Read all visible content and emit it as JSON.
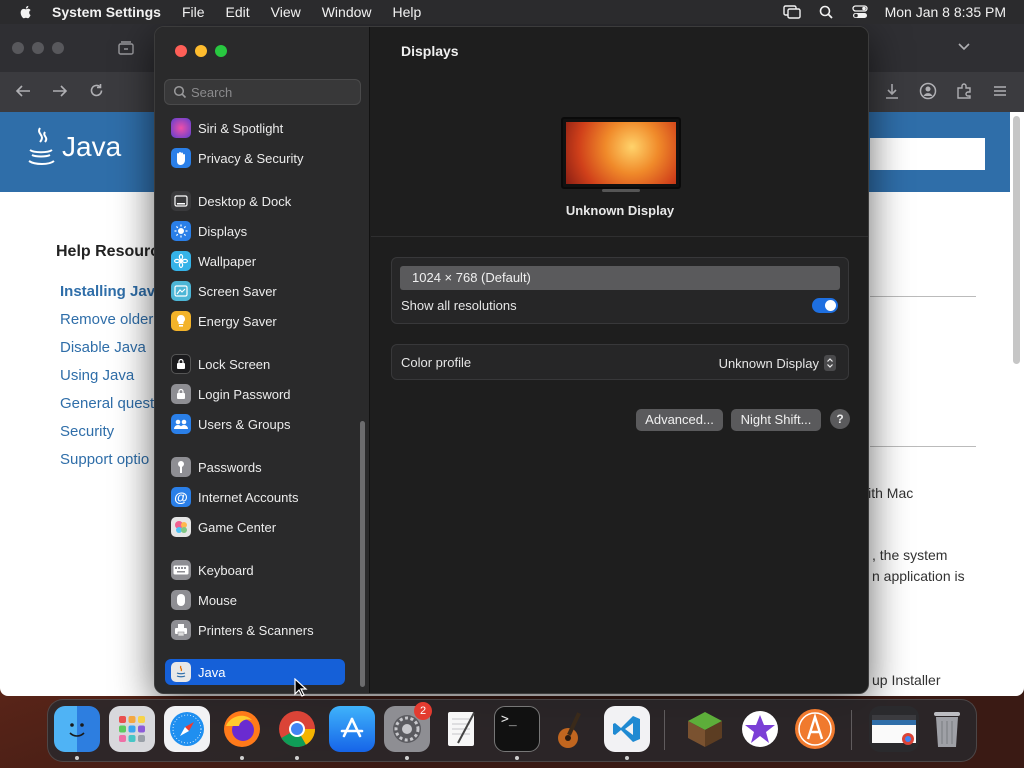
{
  "menubar": {
    "app_name": "System Settings",
    "menus": [
      "File",
      "Edit",
      "View",
      "Window",
      "Help"
    ],
    "datetime": "Mon Jan 8  8:35 PM"
  },
  "browser": {
    "logo_text": "Java",
    "help_heading": "Help Resourc",
    "links": [
      "Installing Java",
      "Remove older",
      "Disable Java",
      "Using Java",
      "General quest",
      "Security",
      "Support optio"
    ],
    "body_snippets": [
      "with Mac",
      ", the system",
      "n application is",
      "up Installer"
    ]
  },
  "settings": {
    "search_placeholder": "Search",
    "sidebar_items": [
      {
        "label": "Siri & Spotlight",
        "icon": "siri-icon",
        "color": "#b03fd1"
      },
      {
        "label": "Privacy & Security",
        "icon": "hand-icon",
        "color": "#2a7fe8"
      },
      {
        "label": "Desktop & Dock",
        "icon": "dock-icon",
        "color": "#3a3a3c"
      },
      {
        "label": "Displays",
        "icon": "sun-icon",
        "color": "#2a7fe8"
      },
      {
        "label": "Wallpaper",
        "icon": "flower-icon",
        "color": "#35b3e8"
      },
      {
        "label": "Screen Saver",
        "icon": "screen-saver-icon",
        "color": "#4db6d6"
      },
      {
        "label": "Energy Saver",
        "icon": "bulb-icon",
        "color": "#f3b32a"
      },
      {
        "label": "Lock Screen",
        "icon": "lock-icon",
        "color": "#1c1c1e"
      },
      {
        "label": "Login Password",
        "icon": "padlock-icon",
        "color": "#8e8e93"
      },
      {
        "label": "Users & Groups",
        "icon": "users-icon",
        "color": "#2a7fe8"
      },
      {
        "label": "Passwords",
        "icon": "key-icon",
        "color": "#8e8e93"
      },
      {
        "label": "Internet Accounts",
        "icon": "at-icon",
        "color": "#2a7fe8"
      },
      {
        "label": "Game Center",
        "icon": "game-center-icon",
        "color": "#e6e6e6"
      },
      {
        "label": "Keyboard",
        "icon": "keyboard-icon",
        "color": "#8e8e93"
      },
      {
        "label": "Mouse",
        "icon": "mouse-icon",
        "color": "#8e8e93"
      },
      {
        "label": "Printers & Scanners",
        "icon": "printer-icon",
        "color": "#8e8e93"
      },
      {
        "label": "Java",
        "icon": "java-icon",
        "color": "#e8e8e8"
      }
    ],
    "selected_item": "Java",
    "title": "Displays",
    "display_name": "Unknown Display",
    "resolution": "1024 × 768 (Default)",
    "show_all_label": "Show all resolutions",
    "show_all_enabled": true,
    "color_profile_label": "Color profile",
    "color_profile_value": "Unknown Display",
    "advanced_label": "Advanced...",
    "night_shift_label": "Night Shift...",
    "help_label": "?"
  },
  "dock": {
    "apps": [
      "Finder",
      "Launchpad",
      "Safari",
      "Firefox",
      "Chrome",
      "App Store",
      "System Settings",
      "TextEdit",
      "Terminal",
      "GarageBand",
      "Visual Studio Code",
      "Minecraft",
      "iMovie",
      "Arc",
      "Chrome window",
      "Trash"
    ],
    "settings_badge": "2"
  }
}
